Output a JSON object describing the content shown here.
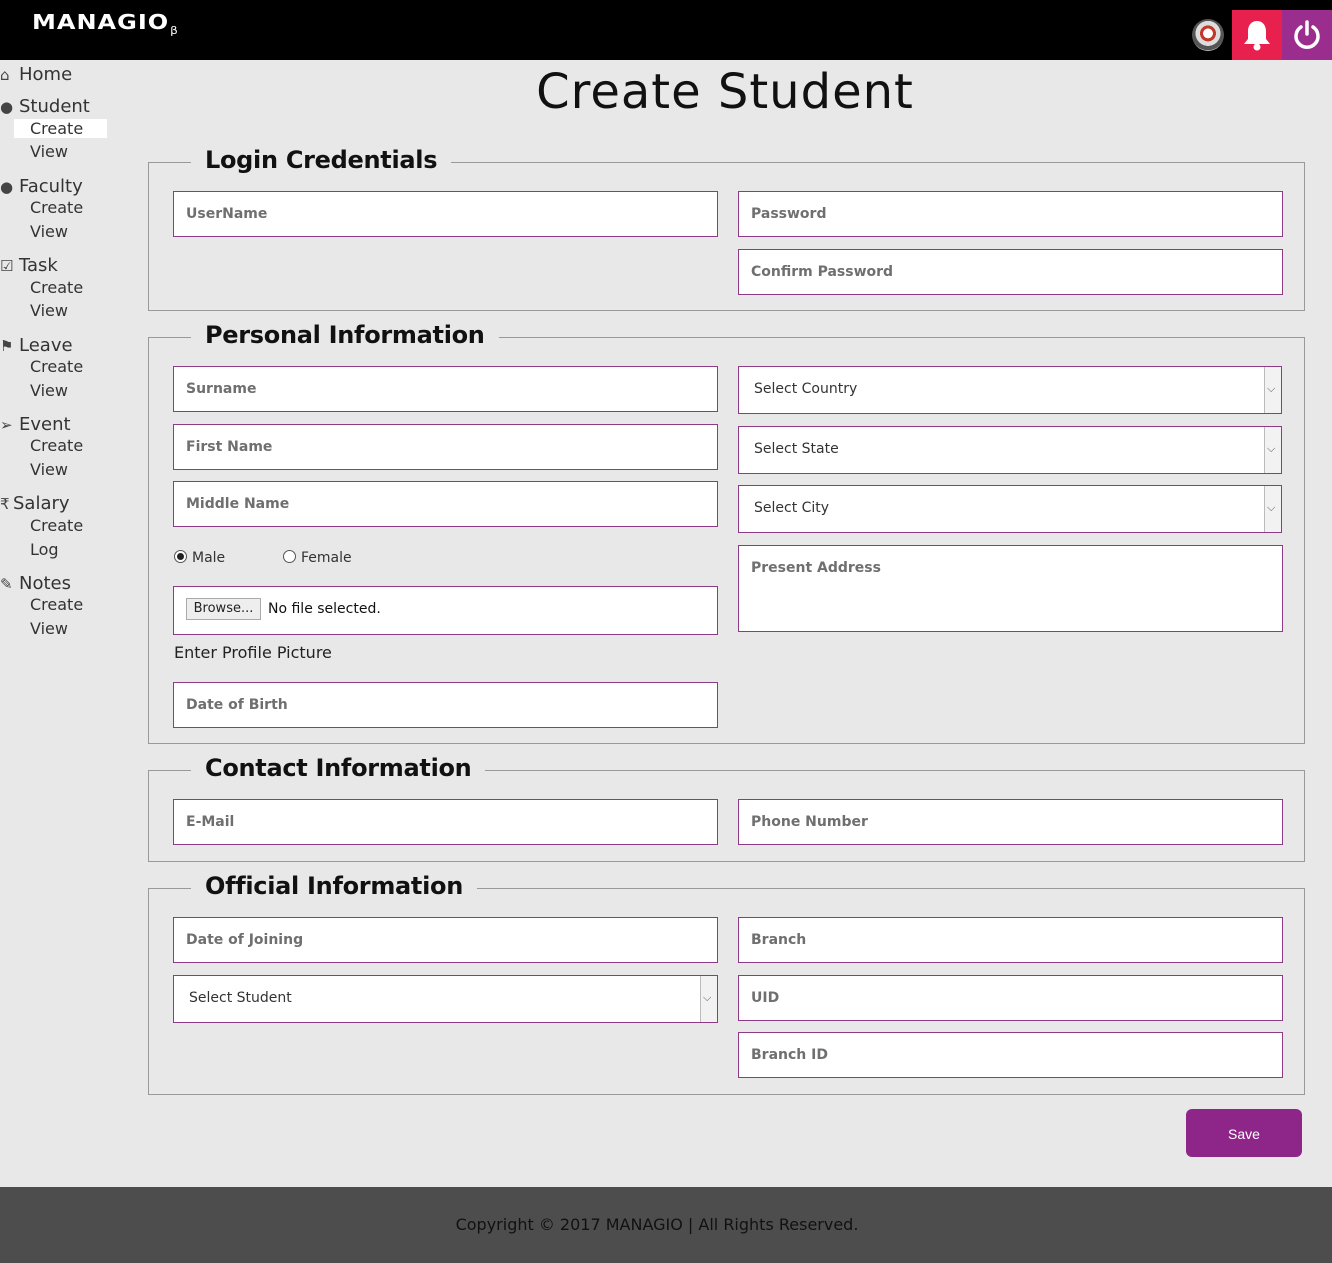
{
  "header": {
    "logo_text": "MANAGIO",
    "logo_suffix": "β"
  },
  "sidebar": {
    "sections": [
      {
        "label": "Home",
        "icon": "home-icon"
      },
      {
        "label": "Student",
        "icon": "users-icon",
        "items": [
          "Create",
          "View"
        ]
      },
      {
        "label": "Faculty",
        "icon": "users-icon",
        "items": [
          "Create",
          "View"
        ]
      },
      {
        "label": "Task",
        "icon": "check-square-icon",
        "items": [
          "Create",
          "View"
        ]
      },
      {
        "label": "Leave",
        "icon": "flag-icon",
        "items": [
          "Create",
          "View"
        ]
      },
      {
        "label": "Event",
        "icon": "paper-plane-icon",
        "items": [
          "Create",
          "View"
        ]
      },
      {
        "label": "Salary",
        "icon": "rupee-icon",
        "items": [
          "Create",
          "Log"
        ]
      },
      {
        "label": "Notes",
        "icon": "edit-icon",
        "items": [
          "Create",
          "View"
        ]
      }
    ],
    "active": "Student > Create"
  },
  "page_title": "Create Student",
  "login": {
    "legend": "Login Credentials",
    "username_placeholder": "UserName",
    "password_placeholder": "Password",
    "confirm_placeholder": "Confirm Password"
  },
  "personal": {
    "legend": "Personal Information",
    "surname_placeholder": "Surname",
    "firstname_placeholder": "First Name",
    "middlename_placeholder": "Middle Name",
    "gender_male": "Male",
    "gender_female": "Female",
    "gender_selected": "Male",
    "browse_label": "Browse...",
    "file_status": "No file selected.",
    "profile_label": "Enter Profile Picture",
    "dob_placeholder": "Date of Birth",
    "country_value": "Select Country",
    "state_value": "Select State",
    "city_value": "Select City",
    "address_placeholder": "Present Address"
  },
  "contact": {
    "legend": "Contact Information",
    "email_placeholder": "E-Mail",
    "phone_placeholder": "Phone Number"
  },
  "official": {
    "legend": "Official Information",
    "doj_placeholder": "Date of Joining",
    "student_select_value": "Select Student",
    "branch_placeholder": "Branch",
    "uid_placeholder": "UID",
    "branch_id_placeholder": "Branch ID"
  },
  "save_label": "Save",
  "footer_text": "Copyright © 2017 MANAGIO | All Rights Reserved.",
  "colors": {
    "accent": "#8e268a",
    "bell": "#e8204e",
    "power": "#9b2d8f",
    "field_border": "#8e3a86"
  }
}
